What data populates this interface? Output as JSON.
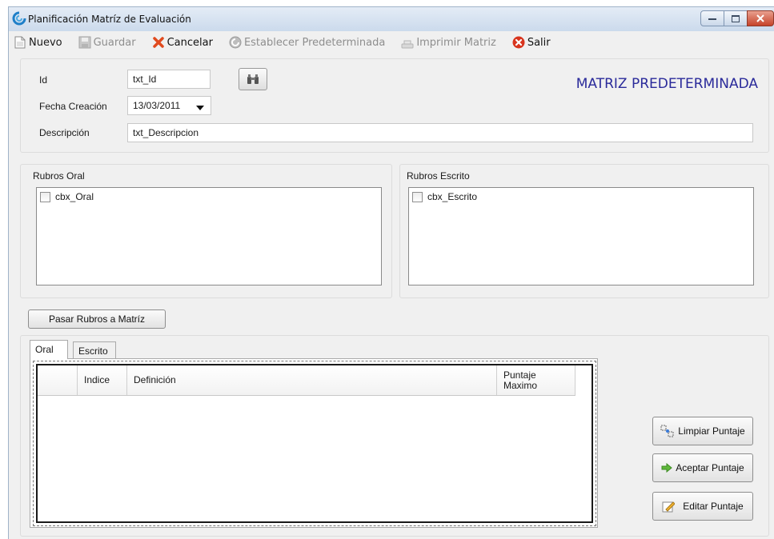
{
  "window": {
    "title": "Planificación Matríz de Evaluación"
  },
  "toolbar": {
    "nuevo": "Nuevo",
    "guardar": "Guardar",
    "cancelar": "Cancelar",
    "establecer": "Establecer Predeterminada",
    "imprimir": "Imprimir Matriz",
    "salir": "Salir"
  },
  "form": {
    "id_label": "Id",
    "id_value": "txt_Id",
    "fecha_label": "Fecha Creación",
    "fecha_value": "13/03/2011",
    "descripcion_label": "Descripción",
    "descripcion_value": "txt_Descripcion",
    "banner": "MATRIZ PREDETERMINADA"
  },
  "rubros": {
    "oral_title": "Rubros Oral",
    "oral_item": "cbx_Oral",
    "escrito_title": "Rubros Escrito",
    "escrito_item": "cbx_Escrito"
  },
  "pasar_button": "Pasar Rubros a Matríz",
  "tabs": {
    "oral": "Oral",
    "escrito": "Escrito"
  },
  "grid": {
    "columns": [
      "",
      "Indice",
      "Definición",
      "Puntaje Maximo"
    ],
    "rows": []
  },
  "actions": {
    "limpiar": "Limpiar Puntaje",
    "aceptar": "Aceptar Puntaje",
    "editar": "Editar Puntaje"
  },
  "colors": {
    "banner": "#2a2a9a",
    "close_button": "#c6432a"
  }
}
